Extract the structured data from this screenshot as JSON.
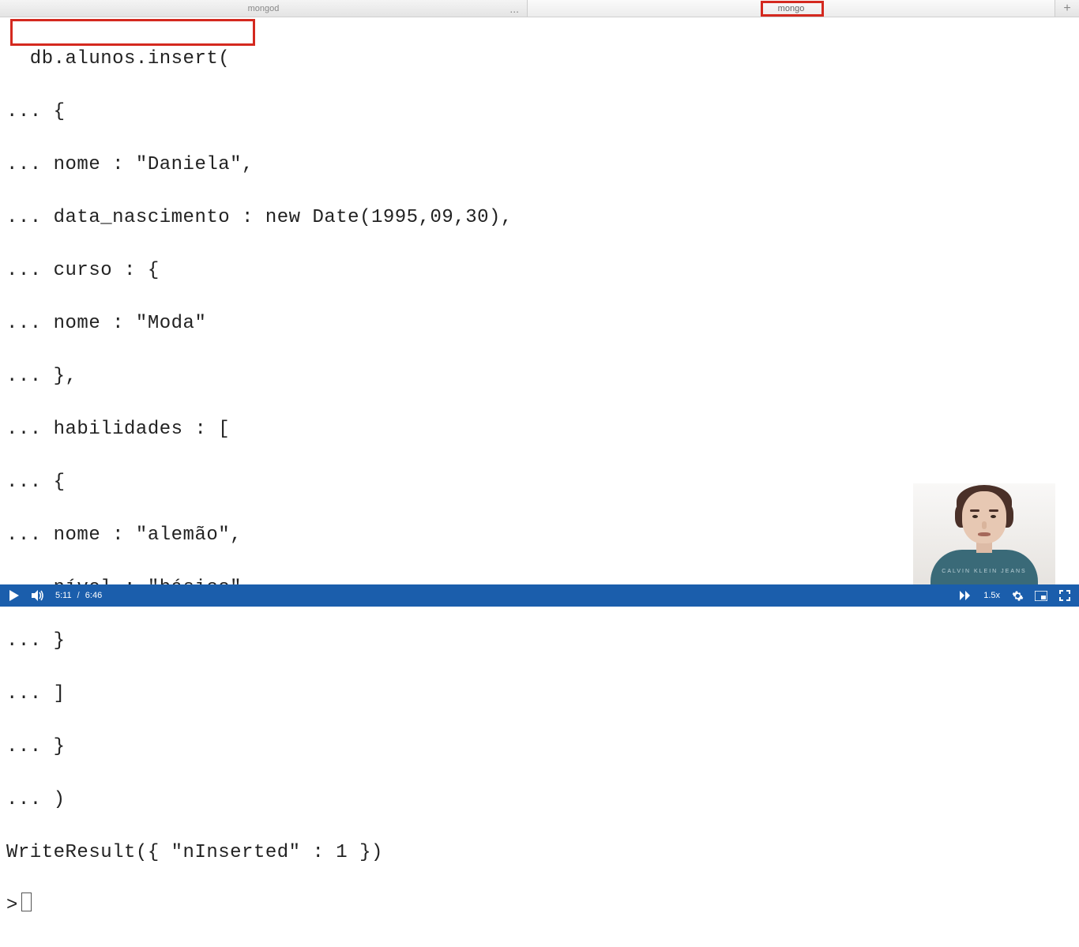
{
  "tabs": {
    "left": "mongod",
    "right": "mongo",
    "ellipsis": "...",
    "new": "+"
  },
  "terminal_lines": [
    "  db.alunos.insert(",
    "... {",
    "... nome : \"Daniela\",",
    "... data_nascimento : new Date(1995,09,30),",
    "... curso : {",
    "... nome : \"Moda\"",
    "... },",
    "... habilidades : [",
    "... {",
    "... nome : \"alemão\",",
    "... nível : \"básico\"",
    "... }",
    "... ]",
    "... }",
    "... )",
    "WriteResult({ \"nInserted\" : 1 })"
  ],
  "prompt": ">",
  "video": {
    "current": "5:11",
    "total": "6:46",
    "sep": "/",
    "speed": "1.5x"
  },
  "presenter_shirt": "CALVIN KLEIN JEANS"
}
